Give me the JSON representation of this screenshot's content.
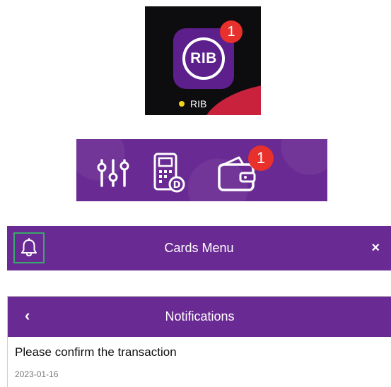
{
  "home_icon": {
    "app_name": "RIB",
    "logo_text": "RIB",
    "badge_count": "1",
    "status_dot_color": "#f2d21b"
  },
  "toolbar": {
    "icons": [
      "sliders-icon",
      "pos-terminal-icon",
      "wallet-icon"
    ],
    "wallet_badge_count": "1"
  },
  "cards_menu": {
    "title": "Cards Menu",
    "close_glyph": "×",
    "bell_icon": "bell-icon"
  },
  "notifications": {
    "title": "Notifications",
    "back_glyph": "‹",
    "items": [
      {
        "message": "Please confirm the transaction",
        "date": "2023-01-16"
      }
    ]
  },
  "colors": {
    "brand_purple": "#6a2a93",
    "badge_red": "#e8302c",
    "highlight_green": "#3aa86b"
  }
}
